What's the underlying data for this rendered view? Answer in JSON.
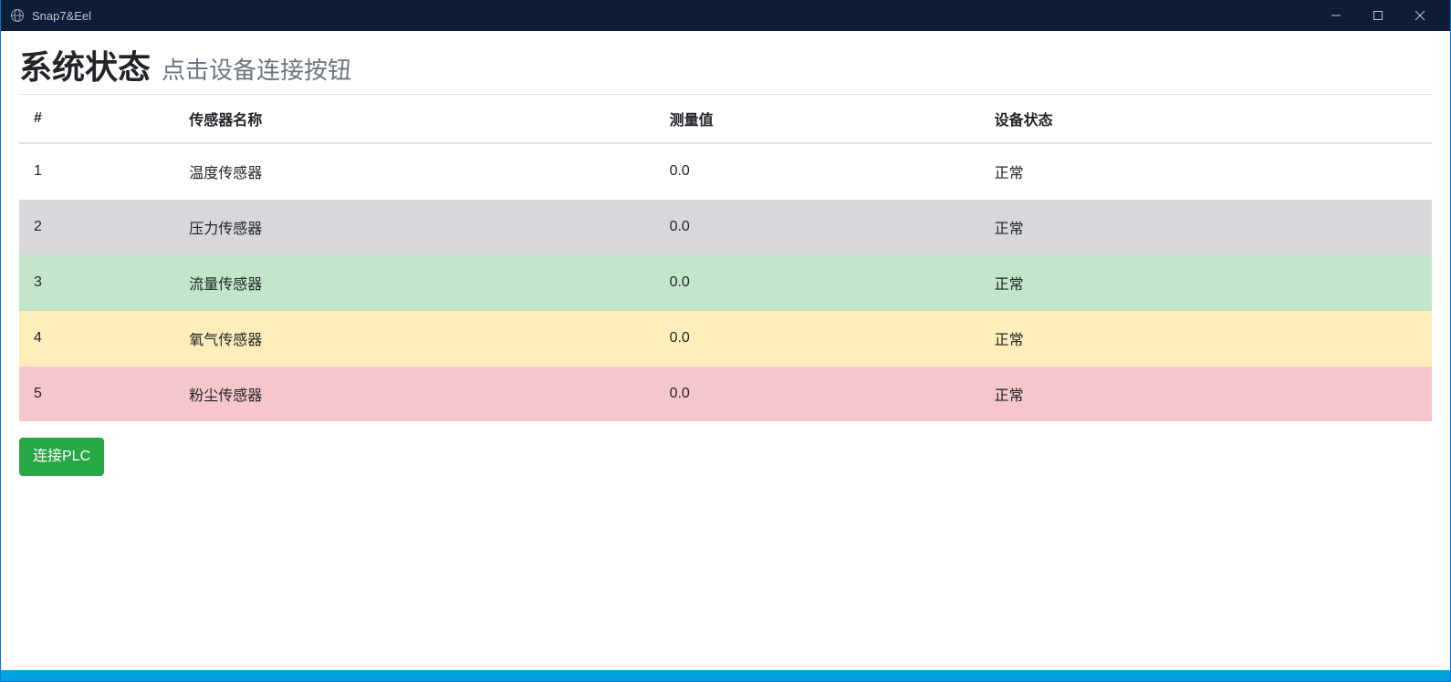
{
  "window": {
    "title": "Snap7&Eel",
    "icon": "globe-icon"
  },
  "header": {
    "title": "系统状态",
    "subtitle": "点击设备连接按钮"
  },
  "table": {
    "columns": {
      "index": "#",
      "name": "传感器名称",
      "value": "测量值",
      "status": "设备状态"
    },
    "rows": [
      {
        "index": "1",
        "name": "温度传感器",
        "value": "0.0",
        "status": "正常",
        "row_class": "row-default"
      },
      {
        "index": "2",
        "name": "压力传感器",
        "value": "0.0",
        "status": "正常",
        "row_class": "row-secondary"
      },
      {
        "index": "3",
        "name": "流量传感器",
        "value": "0.0",
        "status": "正常",
        "row_class": "row-success"
      },
      {
        "index": "4",
        "name": "氧气传感器",
        "value": "0.0",
        "status": "正常",
        "row_class": "row-warning"
      },
      {
        "index": "5",
        "name": "粉尘传感器",
        "value": "0.0",
        "status": "正常",
        "row_class": "row-danger"
      }
    ]
  },
  "buttons": {
    "connect": "连接PLC"
  },
  "colors": {
    "titlebar_bg": "#0d1d36",
    "accent": "#00a3e0",
    "btn_success": "#28a745",
    "row_secondary": "#d6d8db",
    "row_success": "#c3e6cb",
    "row_warning": "#ffeeba",
    "row_danger": "#f5c6cb"
  }
}
